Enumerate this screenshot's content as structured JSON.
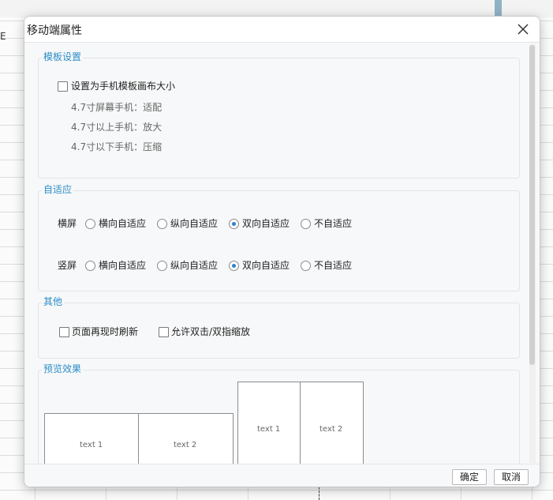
{
  "background": {
    "edge_text": "E"
  },
  "dialog": {
    "title": "移动端属性"
  },
  "template_settings": {
    "title": "模板设置",
    "checkbox_label": "设置为手机模板画布大小",
    "checked": false,
    "hints": [
      "4.7寸屏幕手机：适配",
      "4.7寸以上手机：放大",
      "4.7寸以下手机：压缩"
    ]
  },
  "adaptive": {
    "title": "自适应",
    "options": [
      "横向自适应",
      "纵向自适应",
      "双向自适应",
      "不自适应"
    ],
    "rows": [
      {
        "label": "横屏",
        "selected": "双向自适应"
      },
      {
        "label": "竖屏",
        "selected": "双向自适应"
      }
    ]
  },
  "other": {
    "title": "其他",
    "options": [
      {
        "label": "页面再现时刷新",
        "checked": false
      },
      {
        "label": "允许双击/双指缩放",
        "checked": false
      }
    ]
  },
  "preview": {
    "title": "预览效果",
    "landscape_cells": [
      "text 1",
      "text 2"
    ],
    "portrait_cells": [
      "text 1",
      "text 2"
    ]
  },
  "footer": {
    "confirm_label": "确定",
    "cancel_label": "取消"
  },
  "colors": {
    "section_title": "#2a8ec9",
    "radio_selected": "#2f7fd0"
  }
}
